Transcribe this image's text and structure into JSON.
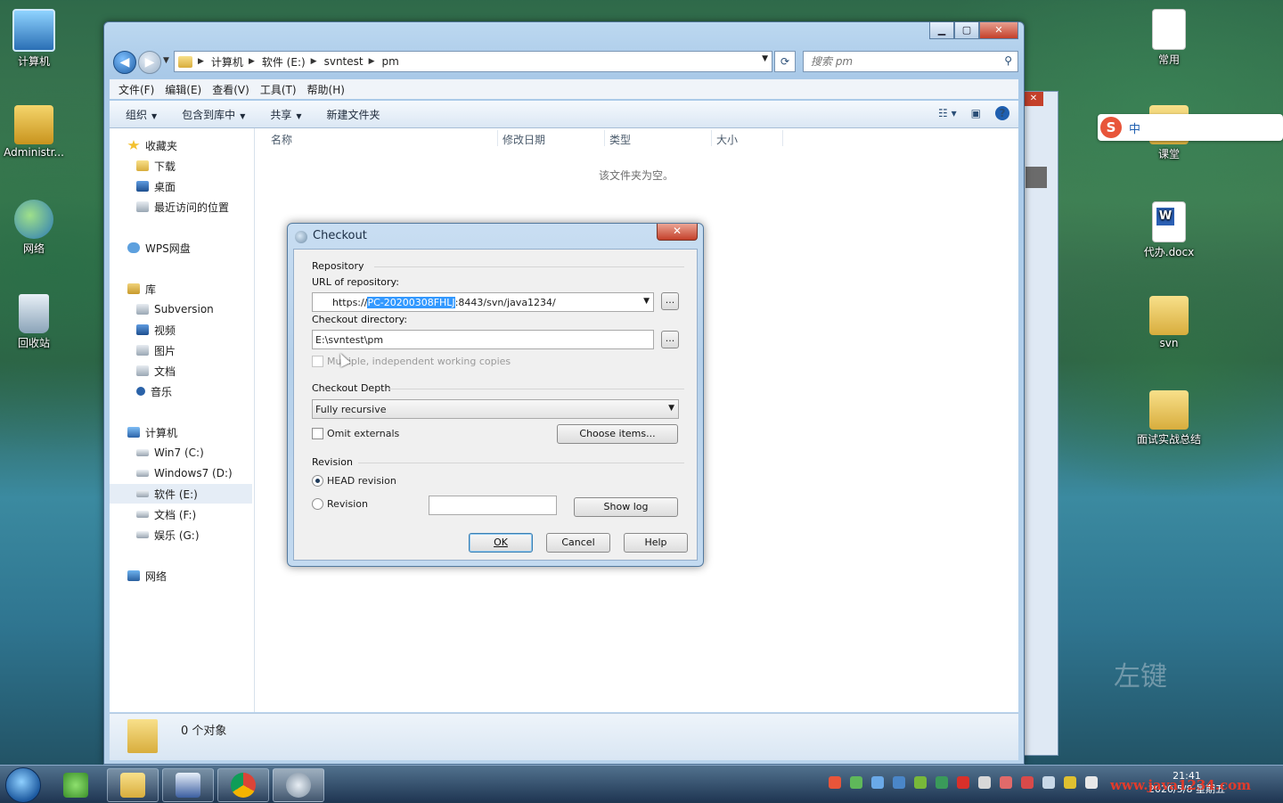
{
  "desktop": {
    "icons_left": [
      {
        "label": "计算机",
        "icon": "computer-icon"
      },
      {
        "label": "Administr...",
        "icon": "user-folder-icon"
      },
      {
        "label": "网络",
        "icon": "network-icon"
      },
      {
        "label": "回收站",
        "icon": "recycle-bin-icon"
      }
    ],
    "icons_right": [
      {
        "label": "常用",
        "icon": "shortcut-document-icon"
      },
      {
        "label": "课堂",
        "icon": "folder-icon"
      },
      {
        "label": "代办.docx",
        "icon": "word-document-icon"
      },
      {
        "label": "svn",
        "icon": "svn-folder-icon"
      },
      {
        "label": "面试实战总结",
        "icon": "folder-icon"
      }
    ],
    "overlay_text": "左键",
    "watermark": "www.java1234.com"
  },
  "ime": {
    "label": "中"
  },
  "explorer": {
    "breadcrumb": [
      "计算机",
      "软件 (E:)",
      "svntest",
      "pm"
    ],
    "search_placeholder": "搜索 pm",
    "menu": [
      "文件(F)",
      "编辑(E)",
      "查看(V)",
      "工具(T)",
      "帮助(H)"
    ],
    "toolbar": [
      "组织",
      "包含到库中",
      "共享",
      "新建文件夹"
    ],
    "nav": {
      "favorites": {
        "label": "收藏夹",
        "items": [
          "下载",
          "桌面",
          "最近访问的位置"
        ]
      },
      "wps": "WPS网盘",
      "library": {
        "label": "库",
        "items": [
          "Subversion",
          "视频",
          "图片",
          "文档",
          "音乐"
        ]
      },
      "computer": {
        "label": "计算机",
        "items": [
          "Win7 (C:)",
          "Windows7 (D:)",
          "软件 (E:)",
          "文档 (F:)",
          "娱乐 (G:)"
        ]
      },
      "network": "网络"
    },
    "columns": [
      "名称",
      "修改日期",
      "类型",
      "大小"
    ],
    "empty_message": "该文件夹为空。",
    "status": "0 个对象"
  },
  "dialog": {
    "title": "Checkout",
    "repository_group": "Repository",
    "url_label": "URL of repository:",
    "url_prefix": "https://",
    "url_selected": "PC-20200308FHLJ",
    "url_suffix": ":8443/svn/java1234/",
    "dir_label": "Checkout directory:",
    "dir_value": "E:\\svntest\\pm",
    "browse": "...",
    "multiple_label": "Multiple, independent working copies",
    "depth_group": "Checkout Depth",
    "depth_value": "Fully recursive",
    "omit_label": "Omit externals",
    "choose_items": "Choose items...",
    "revision_group": "Revision",
    "head_revision": "HEAD revision",
    "revision_label": "Revision",
    "show_log": "Show log",
    "ok": "OK",
    "cancel": "Cancel",
    "help": "Help"
  },
  "taskbar": {
    "clock_time": "21:41",
    "clock_date": "2020/5/8 星期五"
  }
}
